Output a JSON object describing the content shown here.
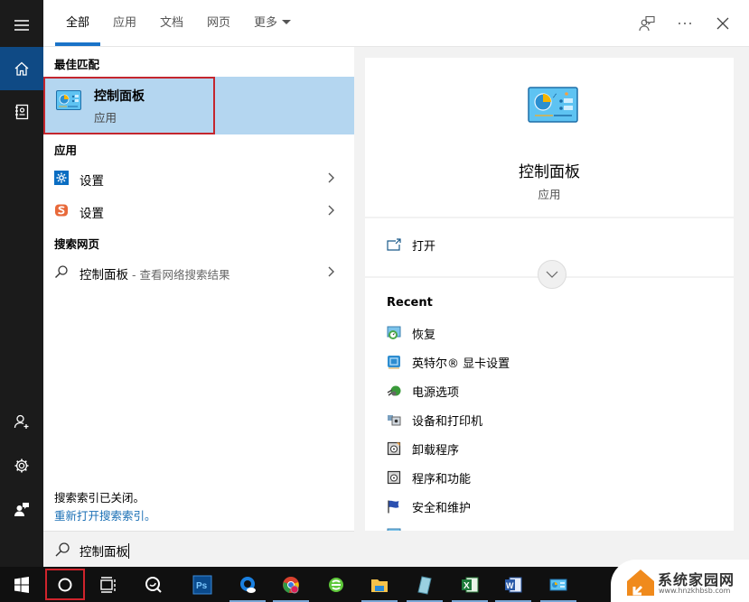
{
  "tabs": [
    {
      "label": "全部",
      "active": true
    },
    {
      "label": "应用",
      "active": false
    },
    {
      "label": "文档",
      "active": false
    },
    {
      "label": "网页",
      "active": false
    },
    {
      "label": "更多",
      "active": false
    }
  ],
  "top_actions": [
    "feedback-icon",
    "more-options-icon",
    "close-icon"
  ],
  "rail": {
    "top": [
      "menu-icon",
      "home-icon",
      "notebook-icon"
    ],
    "bottom": [
      "add-user-icon",
      "gear-icon",
      "feedback-person-icon"
    ],
    "active": "home-icon"
  },
  "results": {
    "best_match_header": "最佳匹配",
    "best_match": {
      "title": "控制面板",
      "subtitle": "应用",
      "icon": "control-panel-icon"
    },
    "apps_header": "应用",
    "apps": [
      {
        "label": "设置",
        "icon": "settings-gear-icon"
      },
      {
        "label": "设置",
        "icon": "sogou-input-icon"
      }
    ],
    "web_header": "搜索网页",
    "web": [
      {
        "label": "控制面板",
        "suffix": " - 查看网络搜索结果",
        "icon": "search-icon"
      }
    ],
    "index_off": "搜索索引已关闭。",
    "index_reopen_link": "重新打开搜索索引。"
  },
  "search": {
    "value": "控制面板",
    "icon": "search-icon"
  },
  "detail": {
    "title": "控制面板",
    "subtitle": "应用",
    "open_label": "打开",
    "recent_header": "Recent",
    "recent": [
      {
        "label": "恢复",
        "icon": "recovery-icon"
      },
      {
        "label": "英特尔® 显卡设置",
        "icon": "intel-graphics-icon"
      },
      {
        "label": "电源选项",
        "icon": "power-options-icon"
      },
      {
        "label": "设备和打印机",
        "icon": "devices-printers-icon"
      },
      {
        "label": "卸载程序",
        "icon": "uninstall-program-icon"
      },
      {
        "label": "程序和功能",
        "icon": "programs-features-icon"
      },
      {
        "label": "安全和维护",
        "icon": "security-maintenance-icon"
      }
    ]
  },
  "taskbar": {
    "items": [
      {
        "name": "start-windows-icon"
      },
      {
        "name": "cortana-search-icon",
        "highlighted": true
      },
      {
        "name": "task-view-icon"
      },
      {
        "name": "search-app-icon"
      },
      {
        "name": "photoshop-icon",
        "label": "Ps"
      },
      {
        "name": "qq-browser-icon"
      },
      {
        "name": "chrome-icon"
      },
      {
        "name": "ie-browser-icon"
      },
      {
        "name": "file-explorer-icon"
      },
      {
        "name": "notepad-icon"
      },
      {
        "name": "excel-icon",
        "label": "X"
      },
      {
        "name": "word-icon",
        "label": "W"
      },
      {
        "name": "control-panel-icon"
      }
    ]
  },
  "watermark": {
    "name": "系统家园网",
    "url": "www.hnzkhbsb.com"
  },
  "colors": {
    "accent": "#1a73c8",
    "selection": "#b4d6f0",
    "highlight_box": "#c4262e",
    "link": "#1a6fb5",
    "rail_bg": "#1b1b1b",
    "rail_active": "#0f4a85"
  }
}
